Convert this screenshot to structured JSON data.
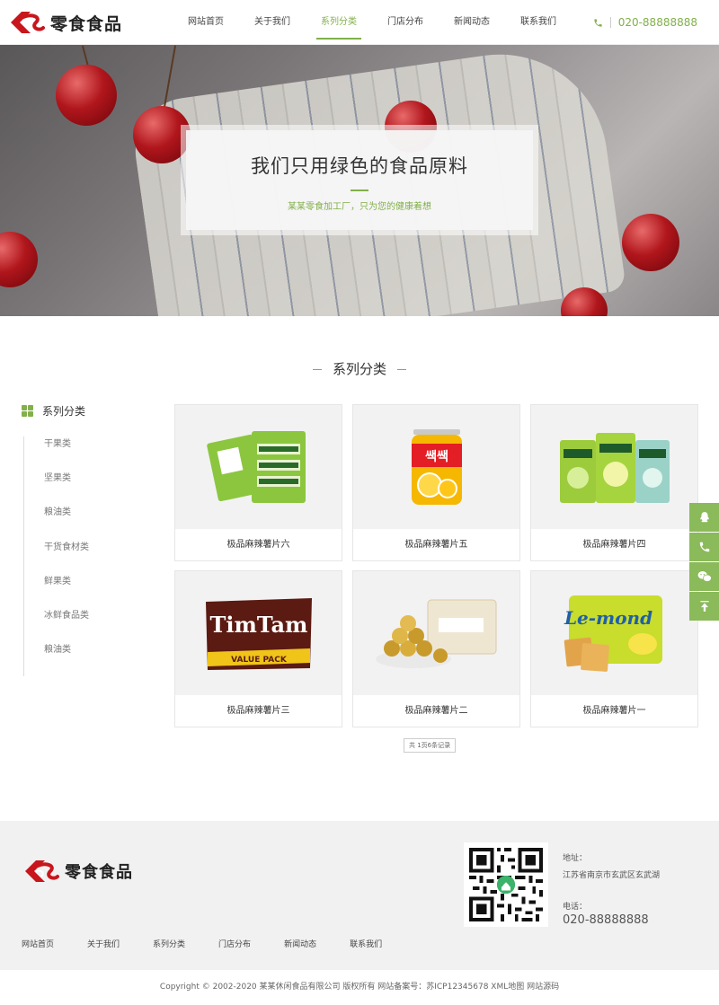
{
  "brand": {
    "name": "零食食品",
    "accent": "#82b04a",
    "logo_red": "#c8161d"
  },
  "nav": {
    "items": [
      {
        "label": "网站首页"
      },
      {
        "label": "关于我们"
      },
      {
        "label": "系列分类",
        "active": true
      },
      {
        "label": "门店分布"
      },
      {
        "label": "新闻动态"
      },
      {
        "label": "联系我们"
      }
    ]
  },
  "header": {
    "phone": "020-88888888",
    "phone_icon": "phone-icon"
  },
  "banner": {
    "title": "我们只用绿色的食品原料",
    "subtitle": "某某零食加工厂，只为您的健康着想"
  },
  "section": {
    "title": "系列分类"
  },
  "sidebar": {
    "title": "系列分类",
    "items": [
      {
        "label": "干果类"
      },
      {
        "label": "坚果类"
      },
      {
        "label": "粮油类"
      },
      {
        "label": "干货食材类"
      },
      {
        "label": "鲜果类"
      },
      {
        "label": "冰鲜食品类"
      },
      {
        "label": "粮油类"
      }
    ]
  },
  "products": [
    {
      "name": "极品麻辣薯片六",
      "image": "doublemint-pack-icon"
    },
    {
      "name": "极品麻辣薯片五",
      "image": "juice-can-icon"
    },
    {
      "name": "极品麻辣薯片四",
      "image": "gum-bags-icon"
    },
    {
      "name": "极品麻辣薯片三",
      "image": "timtam-pack-icon"
    },
    {
      "name": "极品麻辣薯片二",
      "image": "ferrero-box-icon"
    },
    {
      "name": "极品麻辣薯片一",
      "image": "lemond-biscuit-icon"
    }
  ],
  "pager": {
    "text": "共 1页6条记录"
  },
  "float_buttons": [
    "qq-icon",
    "phone-icon",
    "wechat-icon",
    "back-to-top-icon"
  ],
  "footer": {
    "nav": [
      {
        "label": "网站首页"
      },
      {
        "label": "关于我们"
      },
      {
        "label": "系列分类"
      },
      {
        "label": "门店分布"
      },
      {
        "label": "新闻动态"
      },
      {
        "label": "联系我们"
      }
    ],
    "address_label": "地址：",
    "address": "江苏省南京市玄武区玄武湖",
    "phone_label": "电话：",
    "phone": "020-88888888",
    "copyright": "Copyright © 2002-2020 某某休闲食品有限公司 版权所有 网站备案号：苏ICP12345678 XML地图 网站源码"
  }
}
